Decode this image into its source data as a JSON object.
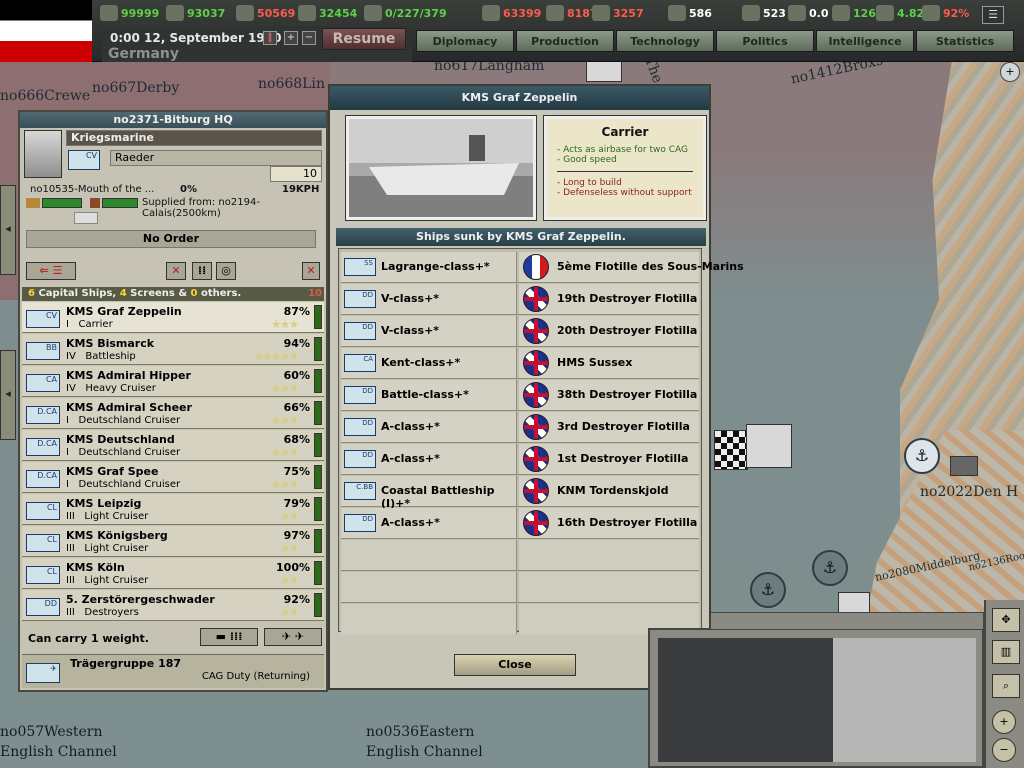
{
  "top": {
    "date": "0:00 12, September 1940",
    "country": "Germany",
    "resume": "Resume",
    "resources": [
      {
        "icon": "energy-icon",
        "value": "99999",
        "color": "#5fd04a"
      },
      {
        "icon": "metal-icon",
        "value": "93037",
        "color": "#5fd04a"
      },
      {
        "icon": "rare-materials-icon",
        "value": "50569",
        "color": "#ff5b4a"
      },
      {
        "icon": "oil-icon",
        "value": "32454",
        "color": "#5fd04a"
      },
      {
        "icon": "ic-icon",
        "value": "0/227/379",
        "color": "#5fd04a"
      },
      {
        "icon": "supplies-icon",
        "value": "63399",
        "color": "#ff5b4a"
      },
      {
        "icon": "fuel-icon",
        "value": "81878",
        "color": "#ff5b4a"
      },
      {
        "icon": "money-icon",
        "value": "3257",
        "color": "#ff5b4a"
      },
      {
        "icon": "manpower-icon",
        "value": "586",
        "color": "#ffffff"
      },
      {
        "icon": "diplomacy-icon",
        "value": "523",
        "color": "#ffffff"
      },
      {
        "icon": "dissent-icon",
        "value": "0.0",
        "color": "#ffffff"
      },
      {
        "icon": "war-exhaustion-icon",
        "value": "126%",
        "color": "#5fd04a"
      },
      {
        "icon": "national-unity-icon",
        "value": "4.82",
        "color": "#5fd04a"
      },
      {
        "icon": "neutrality-icon",
        "value": "92%",
        "color": "#ff5b4a"
      }
    ],
    "tabs": [
      "Diplomacy",
      "Production",
      "Technology",
      "Politics",
      "Intelligence",
      "Statistics"
    ]
  },
  "map_labels": {
    "crewe": "no666Crewe",
    "derby": "no667Derby",
    "lincoln": "no668Lin",
    "langham": "no617Langham",
    "brox": "no1412Broxs",
    "den": "no2022Den H",
    "middelburg": "no2080Middelburg",
    "roos": "no2136Roos",
    "western": "no057Western",
    "western2": "English Channel",
    "eastern": "no0536Eastern",
    "eastern2": "English Channel",
    "the": "The"
  },
  "left": {
    "header": "no2371-Bitburg HQ",
    "branch": "Kriegsmarine",
    "commander": "Raeder",
    "strength": "10",
    "location": "no10535-Mouth of the ...",
    "loc_pct": "0%",
    "speed": "19KPH",
    "supplied": "Supplied from: no2194-Calais(2500km)",
    "order": "No Order",
    "summary": {
      "c1": "6",
      "t1": " Capital Ships, ",
      "c2": "4",
      "t2": " Screens & ",
      "c3": "0",
      "t3": " others.",
      "right": "10"
    },
    "ships": [
      {
        "name": "KMS Graf Zeppelin",
        "tier": "I",
        "type": "Carrier",
        "pct": "87%",
        "stars": "★★★",
        "code": "CV"
      },
      {
        "name": "KMS Bismarck",
        "tier": "IV",
        "type": "Battleship",
        "pct": "94%",
        "stars": "★★★★★",
        "code": "BB"
      },
      {
        "name": "KMS Admiral Hipper",
        "tier": "IV",
        "type": "Heavy Cruiser",
        "pct": "60%",
        "stars": "★★★",
        "code": "CA"
      },
      {
        "name": "KMS Admiral Scheer",
        "tier": "I",
        "type": "Deutschland Cruiser",
        "pct": "66%",
        "stars": "★★★",
        "code": "D.CA"
      },
      {
        "name": "KMS Deutschland",
        "tier": "I",
        "type": "Deutschland Cruiser",
        "pct": "68%",
        "stars": "★★★",
        "code": "D.CA"
      },
      {
        "name": "KMS Graf Spee",
        "tier": "I",
        "type": "Deutschland Cruiser",
        "pct": "75%",
        "stars": "★★★",
        "code": "D.CA"
      },
      {
        "name": "KMS Leipzig",
        "tier": "III",
        "type": "Light Cruiser",
        "pct": "79%",
        "stars": "★★",
        "code": "CL"
      },
      {
        "name": "KMS Königsberg",
        "tier": "III",
        "type": "Light Cruiser",
        "pct": "97%",
        "stars": "★★",
        "code": "CL"
      },
      {
        "name": "KMS Köln",
        "tier": "III",
        "type": "Light Cruiser",
        "pct": "100%",
        "stars": "★★",
        "code": "CL"
      },
      {
        "name": "5. Zerstörergeschwader",
        "tier": "III",
        "type": "Destroyers",
        "pct": "92%",
        "stars": "★★",
        "code": "DD"
      }
    ],
    "carry": "Can carry 1 weight.",
    "cag_name": "Trägergruppe 187",
    "cag_status": "CAG Duty (Returning)"
  },
  "dialog": {
    "title": "KMS Graf Zeppelin",
    "desc_title": "Carrier",
    "pros": [
      "- Acts as airbase for two CAG",
      "- Good speed"
    ],
    "cons": [
      "- Long to build",
      "- Defenseless without support"
    ],
    "sunk_title": "Ships sunk by KMS Graf Zeppelin.",
    "sunk": [
      {
        "code": "SS",
        "cls": "Lagrange-class+*",
        "flag": "fr",
        "victim": "5ème Flotille des Sous-Marins"
      },
      {
        "code": "DD",
        "cls": "V-class+*",
        "flag": "uk",
        "victim": "19th Destroyer Flotilla"
      },
      {
        "code": "DD",
        "cls": "V-class+*",
        "flag": "uk",
        "victim": "20th Destroyer Flotilla"
      },
      {
        "code": "CA",
        "cls": "Kent-class+*",
        "flag": "uk",
        "victim": "HMS Sussex"
      },
      {
        "code": "DD",
        "cls": "Battle-class+*",
        "flag": "uk",
        "victim": "38th Destroyer Flotilla"
      },
      {
        "code": "DD",
        "cls": "A-class+*",
        "flag": "uk",
        "victim": "3rd Destroyer Flotilla"
      },
      {
        "code": "DD",
        "cls": "A-class+*",
        "flag": "uk",
        "victim": "1st Destroyer Flotilla"
      },
      {
        "code": "C.BB",
        "cls": "Coastal Battleship (I)+*",
        "flag": "uk",
        "victim": "KNM Tordenskjold"
      },
      {
        "code": "DD",
        "cls": "A-class+*",
        "flag": "uk",
        "victim": "16th Destroyer Flotilla"
      }
    ],
    "close": "Close"
  }
}
